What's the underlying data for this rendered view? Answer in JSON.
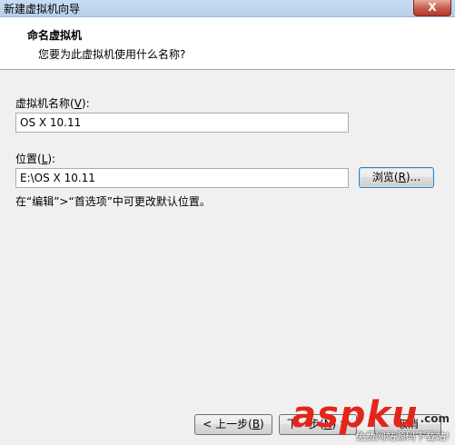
{
  "window": {
    "title": "新建虚拟机向导",
    "close_glyph": "X"
  },
  "header": {
    "title": "命名虚拟机",
    "subtitle": "您要为此虚拟机使用什么名称?"
  },
  "name_field": {
    "label": "虚拟机名称(",
    "label_key": "V",
    "label_end": "):",
    "value": "OS X 10.11"
  },
  "location_field": {
    "label": "位置(",
    "label_key": "L",
    "label_end": "):",
    "value": "E:\\OS X 10.11"
  },
  "browse_button": {
    "label": "浏览(",
    "key": "R",
    "label_end": ")..."
  },
  "hint": "在“编辑”>“首选项”中可更改默认位置。",
  "buttons": {
    "back": {
      "label": "< 上一步(",
      "key": "B",
      "label_end": ")"
    },
    "next": {
      "label": "下一步(",
      "key": "N",
      "label_end": ") >"
    },
    "cancel": "取消"
  },
  "watermark": {
    "text": "aspku",
    "suffix": ".com",
    "subtext": "免费网站源码下载站!",
    "color": "#e3261b"
  }
}
